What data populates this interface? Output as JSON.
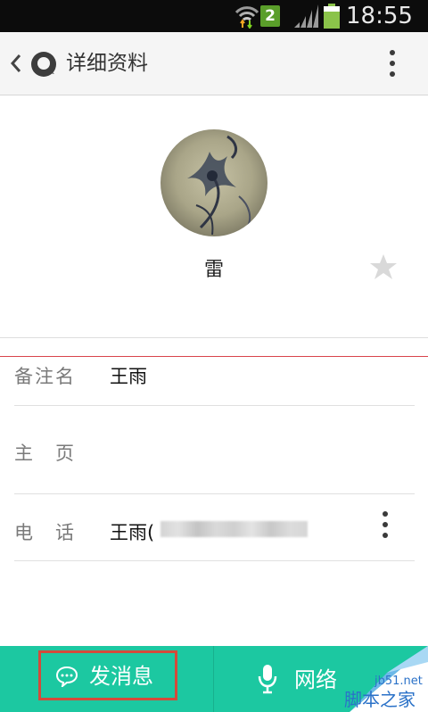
{
  "status_bar": {
    "notification_badge": "2",
    "time": "18:55",
    "icons": [
      "wifi-icon",
      "cellular-signal-icon",
      "battery-icon"
    ]
  },
  "header": {
    "title": "详细资料",
    "icons": [
      "back-icon",
      "app-logo",
      "more-options-icon"
    ]
  },
  "profile": {
    "nickname": "雷",
    "star_icon": "star-icon"
  },
  "info_rows": [
    {
      "label": "备注名",
      "value": "王雨"
    },
    {
      "label": "主　页",
      "value": ""
    },
    {
      "label": "电　话",
      "value": "王雨("
    }
  ],
  "bottom_bar": {
    "send_message_label": "发消息",
    "call_label": "网络",
    "accent": "#1cc8a1"
  },
  "watermark": {
    "site": "jb51.net",
    "name": "脚本之家"
  }
}
